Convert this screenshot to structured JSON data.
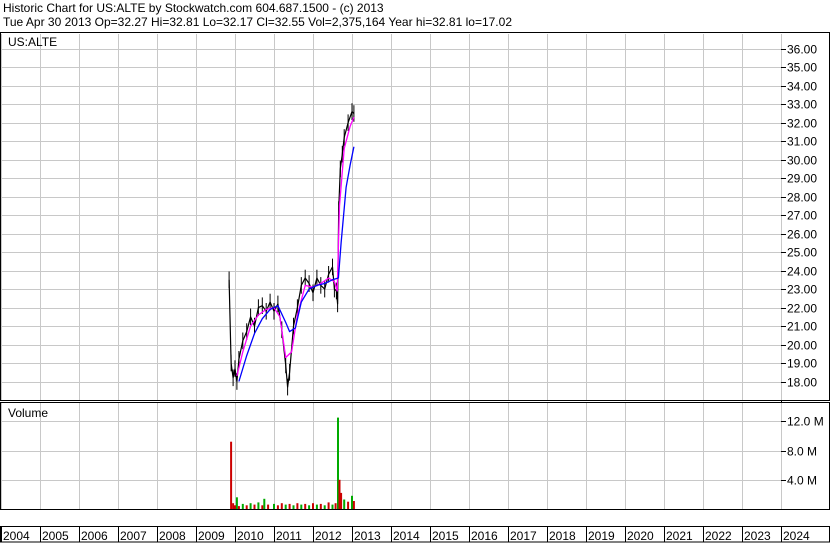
{
  "header": {
    "line1": "Historic Chart for US:ALTE by Stockwatch.com 604.687.1500 - (c) 2013",
    "line2": "Tue Apr 30 2013   Op=32.27   Hi=32.81   Lo=32.17   Cl=32.55   Vol=2,375,164   Year hi=32.81   lo=17.02"
  },
  "chart_data": [
    {
      "type": "line",
      "title": "US:ALTE",
      "y_ticks": [
        "36.00",
        "35.00",
        "34.00",
        "33.00",
        "32.00",
        "31.00",
        "30.00",
        "29.00",
        "28.00",
        "27.00",
        "26.00",
        "25.00",
        "24.00",
        "23.00",
        "22.00",
        "21.00",
        "20.00",
        "19.00",
        "18.00"
      ],
      "ylim": [
        17.0,
        36.8
      ],
      "x_years": [
        "2004",
        "2005",
        "2006",
        "2007",
        "2008",
        "2009",
        "2010",
        "2011",
        "2012",
        "2013",
        "2014",
        "2015",
        "2016",
        "2017",
        "2018",
        "2019",
        "2020",
        "2021",
        "2022",
        "2023",
        "2024"
      ],
      "grid": true,
      "series": [
        {
          "color": "#000000",
          "points": [
            [
              2009.85,
              23.5
            ],
            [
              2009.9,
              19.0
            ],
            [
              2009.95,
              18.2
            ],
            [
              2010.0,
              18.7
            ],
            [
              2010.05,
              18.0
            ],
            [
              2010.1,
              19.2
            ],
            [
              2010.2,
              20.2
            ],
            [
              2010.3,
              20.7
            ],
            [
              2010.4,
              21.5
            ],
            [
              2010.5,
              21.0
            ],
            [
              2010.6,
              22.0
            ],
            [
              2010.7,
              22.1
            ],
            [
              2010.8,
              21.8
            ],
            [
              2010.9,
              22.3
            ],
            [
              2011.0,
              21.8
            ],
            [
              2011.1,
              22.2
            ],
            [
              2011.2,
              20.8
            ],
            [
              2011.3,
              18.9
            ],
            [
              2011.35,
              17.7
            ],
            [
              2011.4,
              18.5
            ],
            [
              2011.5,
              21.0
            ],
            [
              2011.6,
              22.0
            ],
            [
              2011.7,
              23.2
            ],
            [
              2011.8,
              23.6
            ],
            [
              2011.9,
              23.3
            ],
            [
              2012.0,
              22.8
            ],
            [
              2012.1,
              23.6
            ],
            [
              2012.2,
              23.2
            ],
            [
              2012.3,
              23.0
            ],
            [
              2012.4,
              23.8
            ],
            [
              2012.5,
              24.2
            ],
            [
              2012.55,
              23.0
            ],
            [
              2012.6,
              22.9
            ],
            [
              2012.63,
              22.2
            ],
            [
              2012.66,
              27.3
            ],
            [
              2012.7,
              29.5
            ],
            [
              2012.75,
              30.3
            ],
            [
              2012.8,
              31.2
            ],
            [
              2012.9,
              32.0
            ],
            [
              2013.0,
              32.6
            ],
            [
              2013.05,
              32.5
            ]
          ]
        },
        {
          "color": "#ff00ff",
          "points": [
            [
              2010.05,
              18.3
            ],
            [
              2010.2,
              19.6
            ],
            [
              2010.4,
              21.0
            ],
            [
              2010.6,
              21.6
            ],
            [
              2010.8,
              21.9
            ],
            [
              2011.0,
              22.0
            ],
            [
              2011.15,
              21.5
            ],
            [
              2011.3,
              19.3
            ],
            [
              2011.45,
              19.6
            ],
            [
              2011.6,
              21.6
            ],
            [
              2011.8,
              23.2
            ],
            [
              2012.0,
              23.1
            ],
            [
              2012.2,
              23.3
            ],
            [
              2012.4,
              23.6
            ],
            [
              2012.55,
              23.4
            ],
            [
              2012.62,
              22.9
            ],
            [
              2012.68,
              27.5
            ],
            [
              2012.8,
              30.6
            ],
            [
              2012.95,
              31.8
            ],
            [
              2013.05,
              32.3
            ]
          ]
        },
        {
          "color": "#0000ff",
          "points": [
            [
              2010.1,
              18.0
            ],
            [
              2010.3,
              19.4
            ],
            [
              2010.5,
              20.6
            ],
            [
              2010.7,
              21.4
            ],
            [
              2010.9,
              21.9
            ],
            [
              2011.1,
              22.1
            ],
            [
              2011.3,
              21.2
            ],
            [
              2011.4,
              20.7
            ],
            [
              2011.55,
              20.9
            ],
            [
              2011.7,
              22.3
            ],
            [
              2011.9,
              23.0
            ],
            [
              2012.1,
              23.2
            ],
            [
              2012.3,
              23.3
            ],
            [
              2012.5,
              23.5
            ],
            [
              2012.65,
              23.6
            ],
            [
              2012.72,
              25.5
            ],
            [
              2012.85,
              28.5
            ],
            [
              2012.95,
              29.7
            ],
            [
              2013.05,
              30.7
            ]
          ]
        }
      ]
    },
    {
      "type": "bar",
      "title": "Volume",
      "y_ticks": [
        "12.0 M",
        "8.0 M",
        "4.0 M"
      ],
      "ylim": [
        0,
        14.5
      ],
      "unit": "M",
      "bars": [
        {
          "x": 2009.9,
          "v": 9.2,
          "c": "#cc0000"
        },
        {
          "x": 2009.95,
          "v": 0.8,
          "c": "#cc0000"
        },
        {
          "x": 2010.0,
          "v": 0.5,
          "c": "#cc0000"
        },
        {
          "x": 2010.05,
          "v": 1.6,
          "c": "#00aa00"
        },
        {
          "x": 2010.1,
          "v": 0.4,
          "c": "#cc0000"
        },
        {
          "x": 2010.2,
          "v": 0.7,
          "c": "#00aa00"
        },
        {
          "x": 2010.3,
          "v": 0.5,
          "c": "#cc0000"
        },
        {
          "x": 2010.4,
          "v": 0.8,
          "c": "#00aa00"
        },
        {
          "x": 2010.5,
          "v": 0.6,
          "c": "#cc0000"
        },
        {
          "x": 2010.6,
          "v": 0.9,
          "c": "#00aa00"
        },
        {
          "x": 2010.7,
          "v": 0.5,
          "c": "#cc0000"
        },
        {
          "x": 2010.75,
          "v": 1.4,
          "c": "#00aa00"
        },
        {
          "x": 2010.85,
          "v": 0.6,
          "c": "#cc0000"
        },
        {
          "x": 2011.0,
          "v": 0.7,
          "c": "#00aa00"
        },
        {
          "x": 2011.1,
          "v": 0.5,
          "c": "#cc0000"
        },
        {
          "x": 2011.2,
          "v": 0.8,
          "c": "#cc0000"
        },
        {
          "x": 2011.3,
          "v": 0.6,
          "c": "#00aa00"
        },
        {
          "x": 2011.4,
          "v": 0.7,
          "c": "#cc0000"
        },
        {
          "x": 2011.5,
          "v": 0.5,
          "c": "#00aa00"
        },
        {
          "x": 2011.6,
          "v": 0.8,
          "c": "#cc0000"
        },
        {
          "x": 2011.7,
          "v": 0.6,
          "c": "#00aa00"
        },
        {
          "x": 2011.8,
          "v": 0.7,
          "c": "#cc0000"
        },
        {
          "x": 2011.9,
          "v": 0.5,
          "c": "#00aa00"
        },
        {
          "x": 2012.0,
          "v": 0.8,
          "c": "#cc0000"
        },
        {
          "x": 2012.1,
          "v": 0.6,
          "c": "#00aa00"
        },
        {
          "x": 2012.2,
          "v": 0.7,
          "c": "#cc0000"
        },
        {
          "x": 2012.3,
          "v": 0.5,
          "c": "#00aa00"
        },
        {
          "x": 2012.4,
          "v": 0.9,
          "c": "#cc0000"
        },
        {
          "x": 2012.5,
          "v": 0.6,
          "c": "#00aa00"
        },
        {
          "x": 2012.58,
          "v": 0.8,
          "c": "#cc0000"
        },
        {
          "x": 2012.64,
          "v": 12.5,
          "c": "#00aa00"
        },
        {
          "x": 2012.68,
          "v": 4.0,
          "c": "#cc0000"
        },
        {
          "x": 2012.72,
          "v": 2.2,
          "c": "#cc0000"
        },
        {
          "x": 2012.8,
          "v": 1.3,
          "c": "#00aa00"
        },
        {
          "x": 2012.9,
          "v": 1.0,
          "c": "#cc0000"
        },
        {
          "x": 2013.0,
          "v": 1.8,
          "c": "#00aa00"
        },
        {
          "x": 2013.05,
          "v": 1.1,
          "c": "#cc0000"
        }
      ]
    }
  ]
}
